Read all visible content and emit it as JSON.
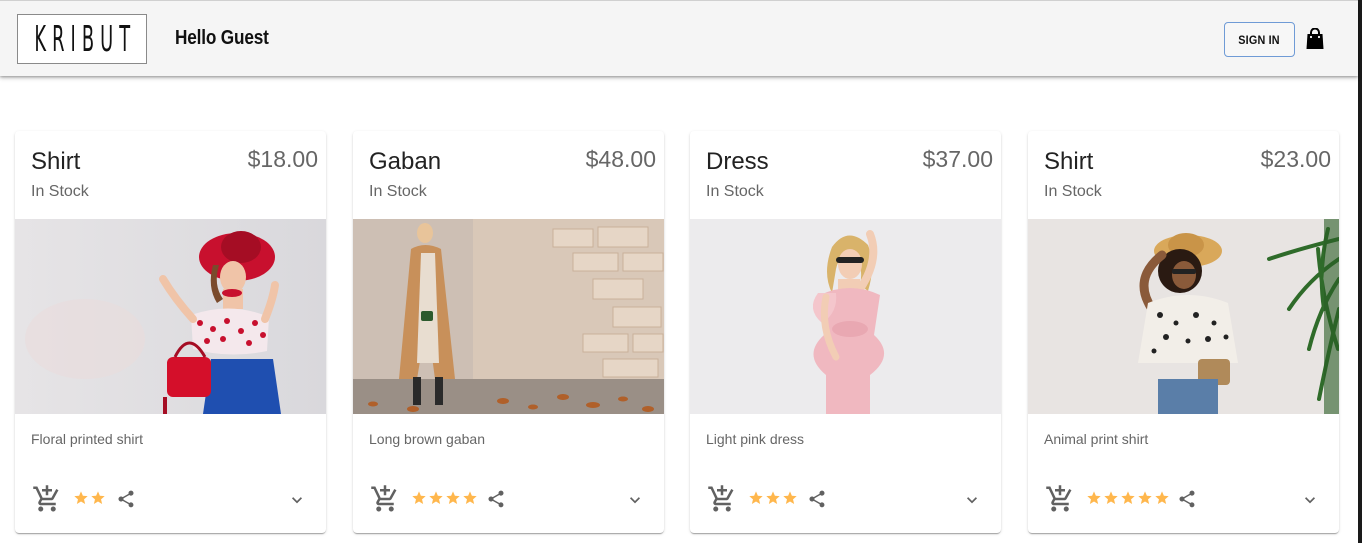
{
  "header": {
    "logo_text": "KRIBUT",
    "greeting": "Hello Guest",
    "signin_label": "SIGN IN"
  },
  "colors": {
    "star": "#ffb74d",
    "icon": "#616161",
    "appbar_bg": "#f5f5f5",
    "signin_border": "#6f9bd6"
  },
  "products": [
    {
      "title": "Shirt",
      "stock": "In Stock",
      "price": "$18.00",
      "description": "Floral printed shirt",
      "rating": 2
    },
    {
      "title": "Gaban",
      "stock": "In Stock",
      "price": "$48.00",
      "description": "Long brown gaban",
      "rating": 4
    },
    {
      "title": "Dress",
      "stock": "In Stock",
      "price": "$37.00",
      "description": "Light pink dress",
      "rating": 3
    },
    {
      "title": "Shirt",
      "stock": "In Stock",
      "price": "$23.00",
      "description": "Animal print shirt",
      "rating": 5
    }
  ],
  "icons": {
    "cart": "add-shopping-cart-icon",
    "share": "share-icon",
    "expand": "chevron-down-icon",
    "bag": "shopping-bag-icon",
    "star": "star-icon"
  }
}
